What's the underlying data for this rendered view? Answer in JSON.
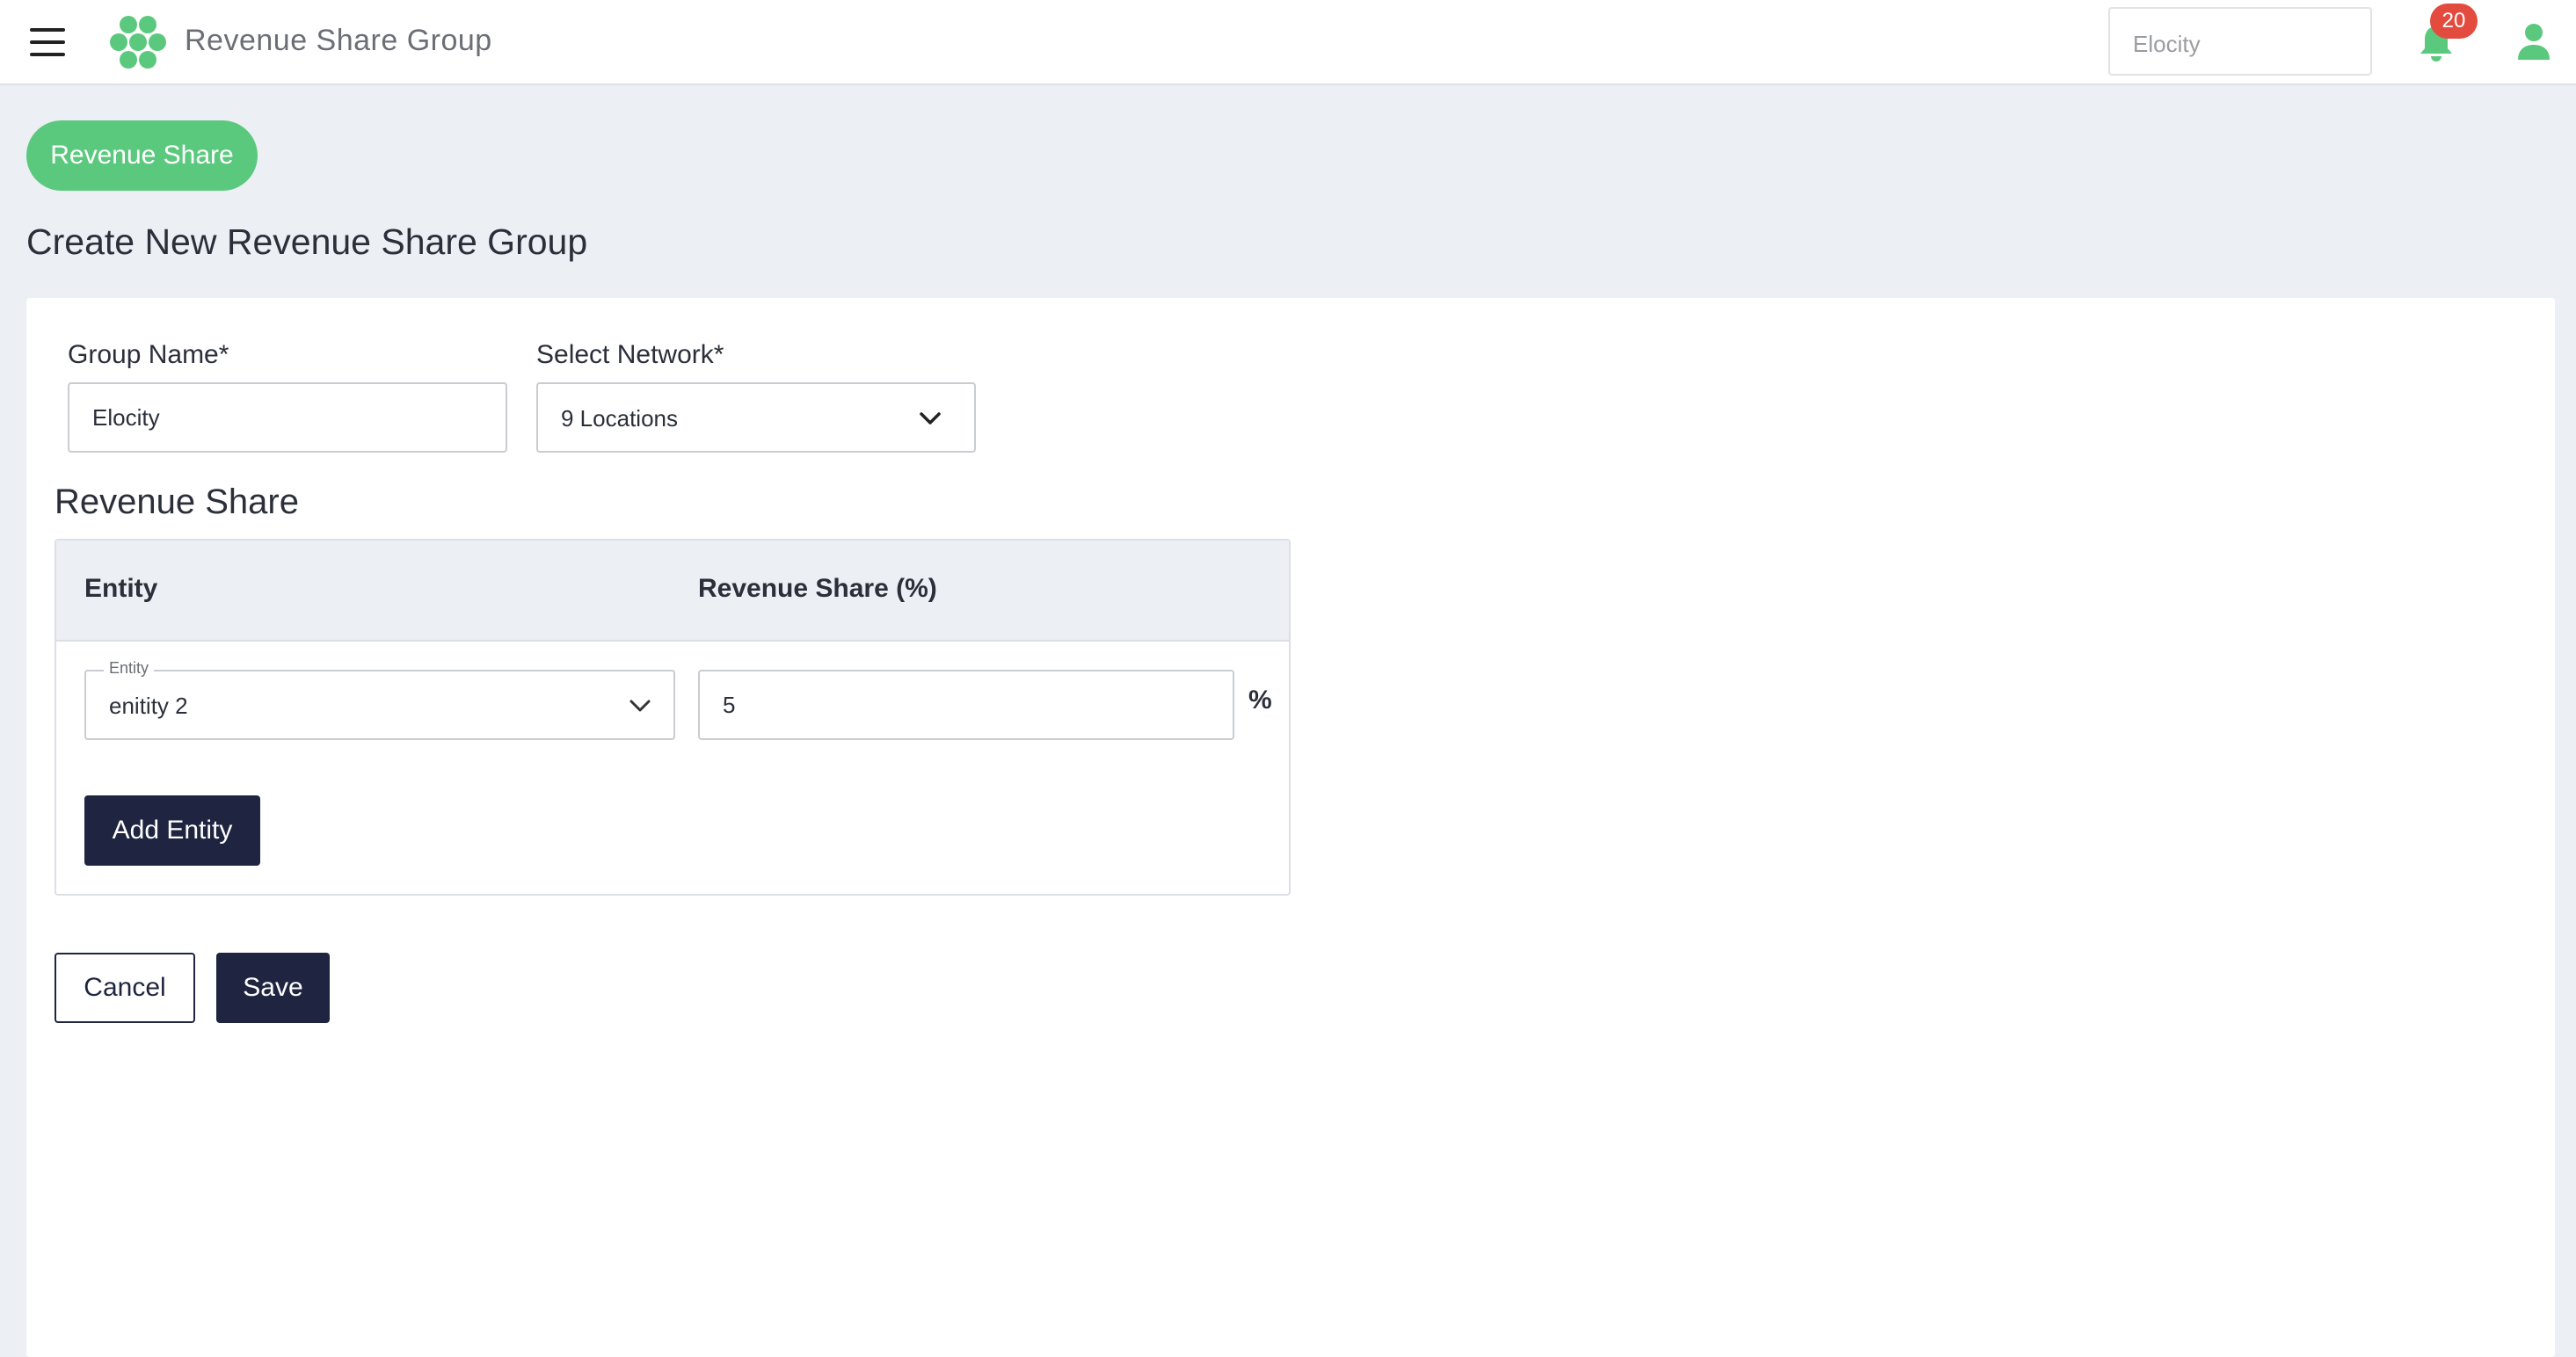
{
  "header": {
    "title": "Revenue Share Group",
    "network_selector_value": "Elocity",
    "notification_count": "20",
    "brand_color": "#5bc97d"
  },
  "page": {
    "breadcrumb_button": "Revenue Share",
    "title": "Create New Revenue Share Group"
  },
  "form": {
    "group_name_label": "Group Name*",
    "group_name_value": "Elocity",
    "network_label": "Select Network*",
    "network_value": "9 Locations"
  },
  "revenue_share": {
    "section_title": "Revenue Share",
    "columns": [
      "Entity",
      "Revenue Share (%)"
    ],
    "rows": [
      {
        "entity_label": "Entity",
        "entity_value": "enitity 2",
        "share_value": "5",
        "share_unit": "%"
      }
    ],
    "add_entity_label": "Add Entity"
  },
  "actions": {
    "cancel_label": "Cancel",
    "save_label": "Save"
  },
  "icons": [
    "menu-icon",
    "logo-icon",
    "bell-icon",
    "user-icon",
    "chevron-down-icon"
  ]
}
